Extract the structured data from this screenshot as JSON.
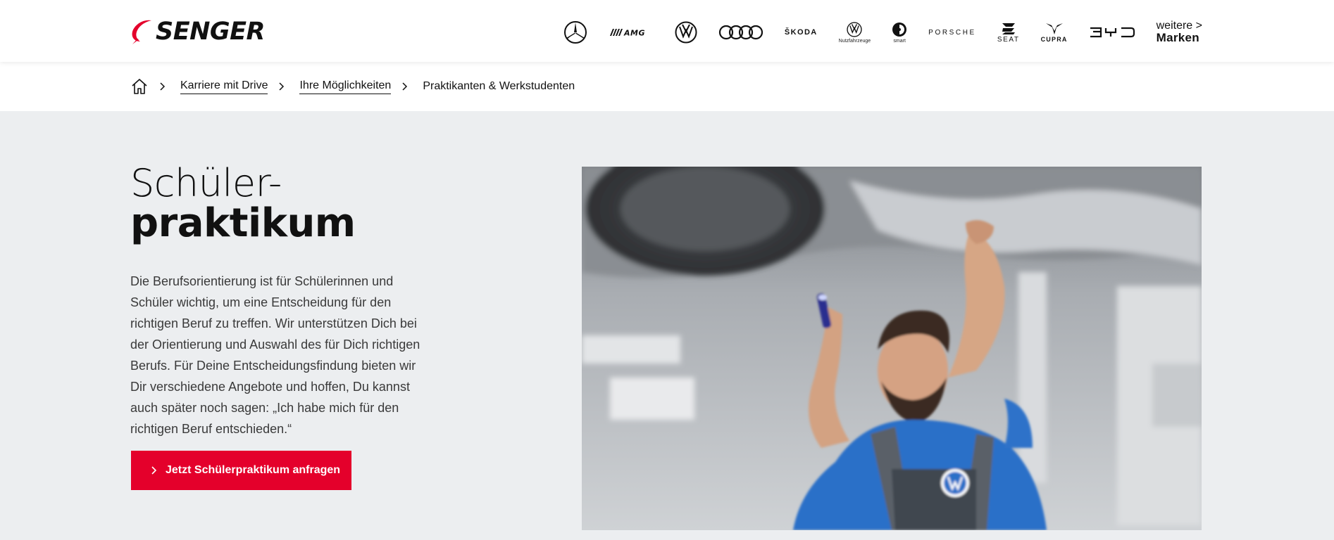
{
  "header": {
    "logo_text": "SENGER",
    "brands": [
      {
        "name": "mercedes-benz",
        "icon": "mercedes-star-icon"
      },
      {
        "name": "amg",
        "label": "AMG",
        "icon": "amg-logo"
      },
      {
        "name": "volkswagen",
        "icon": "vw-logo"
      },
      {
        "name": "audi",
        "icon": "audi-rings-logo"
      },
      {
        "name": "skoda",
        "label": "ŠKODA"
      },
      {
        "name": "vw-nutzfahrzeuge",
        "icon": "vw-logo",
        "sub": "Nutzfahrzeuge"
      },
      {
        "name": "smart",
        "icon": "smart-logo",
        "sub": "smart"
      },
      {
        "name": "porsche",
        "label": "PORSCHE"
      },
      {
        "name": "seat",
        "label": "SEAT",
        "icon": "seat-logo"
      },
      {
        "name": "cupra",
        "label": "CUPRA",
        "icon": "cupra-logo"
      },
      {
        "name": "byd",
        "label": "BYD"
      }
    ],
    "more_brands_line1": "weitere >",
    "more_brands_line2": "Marken"
  },
  "breadcrumb": {
    "home_icon": "home-icon",
    "items": [
      {
        "label": "Karriere mit Drive"
      },
      {
        "label": "Ihre Möglichkeiten"
      },
      {
        "label": "Praktikanten & Werkstudenten"
      }
    ]
  },
  "main": {
    "title_light": "Schüler-",
    "title_bold": "praktikum",
    "description": "Die Berufsorientierung ist für Schülerinnen und Schüler wichtig, um eine Entscheidung für den richtigen Beruf zu treffen. Wir unterstützen Dich bei der Orientierung und Auswahl des für Dich richtigen Berufs. Für Deine Entscheidungsfindung bieten wir Dir verschiedene Angebote und hoffen, Du kannst auch später noch sagen: „Ich habe mich für den richtigen Beruf entschieden.“",
    "cta_label": "Jetzt Schülerpraktikum anfragen"
  },
  "colors": {
    "accent": "#e4002b",
    "page_bg": "#eceef0",
    "header_bg": "#ffffff",
    "text": "#111111"
  }
}
